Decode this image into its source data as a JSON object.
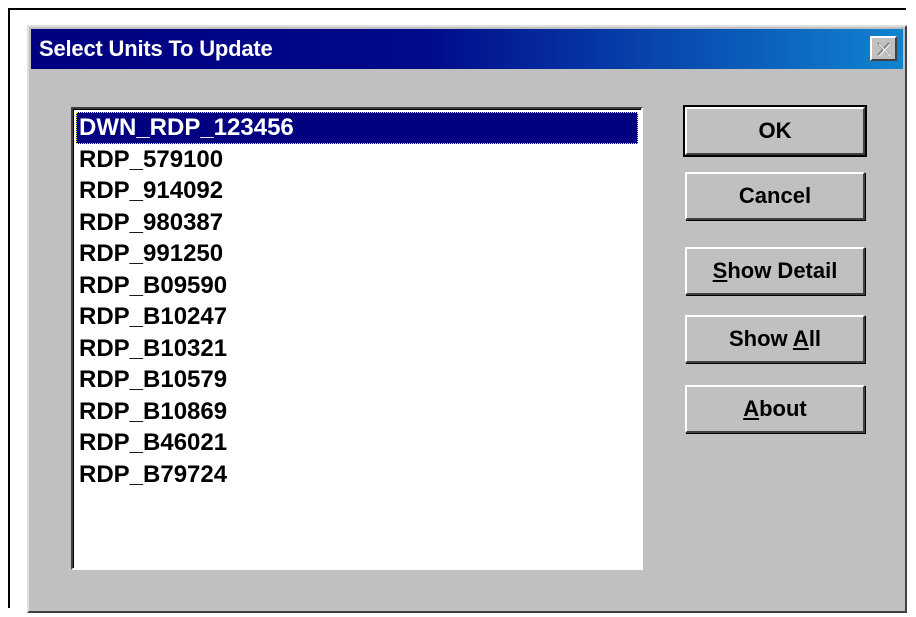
{
  "window": {
    "title": "Select Units To Update"
  },
  "list": {
    "items": [
      {
        "label": "DWN_RDP_123456",
        "selected": true
      },
      {
        "label": "RDP_579100",
        "selected": false
      },
      {
        "label": "RDP_914092",
        "selected": false
      },
      {
        "label": "RDP_980387",
        "selected": false
      },
      {
        "label": "RDP_991250",
        "selected": false
      },
      {
        "label": "RDP_B09590",
        "selected": false
      },
      {
        "label": "RDP_B10247",
        "selected": false
      },
      {
        "label": "RDP_B10321",
        "selected": false
      },
      {
        "label": "RDP_B10579",
        "selected": false
      },
      {
        "label": "RDP_B10869",
        "selected": false
      },
      {
        "label": "RDP_B46021",
        "selected": false
      },
      {
        "label": "RDP_B79724",
        "selected": false
      }
    ]
  },
  "buttons": {
    "ok": {
      "label": "OK"
    },
    "cancel": {
      "label": "Cancel"
    },
    "show_detail": {
      "mnemonic": "S",
      "rest": "how Detail"
    },
    "show_all": {
      "prefix": "Show ",
      "mnemonic": "A",
      "rest": "ll"
    },
    "about": {
      "mnemonic": "A",
      "rest": "bout"
    }
  },
  "icons": {
    "close": "close-icon"
  },
  "colors": {
    "titlebar": "#000080",
    "dialog_bg": "#c0c0c0",
    "selection": "#000080"
  }
}
